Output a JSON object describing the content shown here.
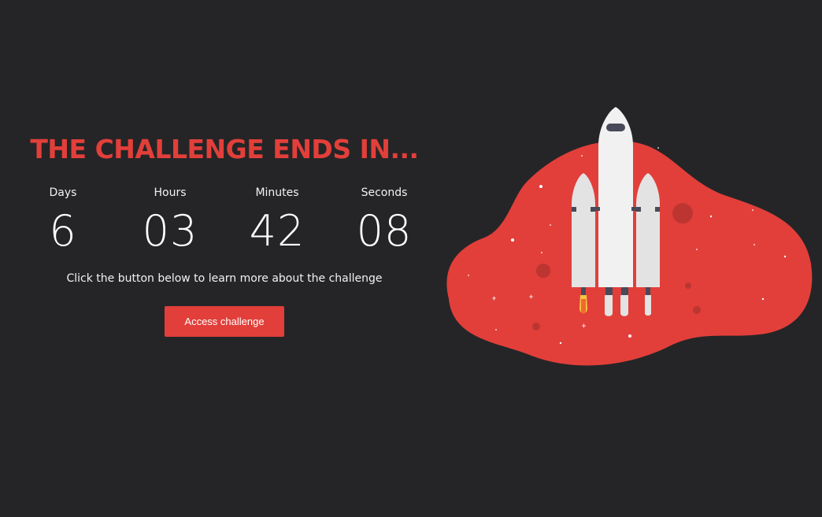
{
  "countdown": {
    "title": "THE CHALLENGE ENDS IN...",
    "units": {
      "days": {
        "label": "Days",
        "value": "6"
      },
      "hours": {
        "label": "Hours",
        "value": "03"
      },
      "minutes": {
        "label": "Minutes",
        "value": "42"
      },
      "seconds": {
        "label": "Seconds",
        "value": "08"
      }
    }
  },
  "info_text": "Click the button below to learn more about the challenge",
  "cta": {
    "label": "Access challenge"
  },
  "illustration": {
    "icon": "rocket-launch-icon",
    "colors": {
      "blob": "#e23f3a",
      "rocket": "#eeeeee",
      "accent": "#484a59",
      "flame": "#f6c445"
    }
  },
  "theme": {
    "background": "#252527",
    "accent": "#e23f3a",
    "text": "#ffffff"
  }
}
